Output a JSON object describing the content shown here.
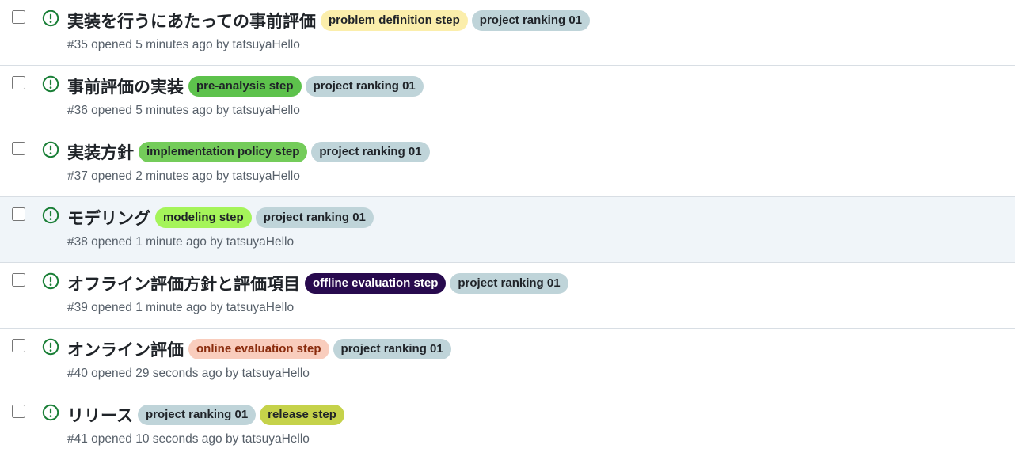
{
  "status_icon": "issue-opened-icon",
  "colors": {
    "open_icon": "#1a7f37",
    "meta_text": "#57606a",
    "row_border": "#d8dee4",
    "hover_row": "#f0f5f9"
  },
  "issues": [
    {
      "title": "実装を行うにあたっての事前評価",
      "meta": "#35 opened 5 minutes ago by tatsuyaHello",
      "labels": [
        {
          "name": "problem definition step",
          "bg": "#fbeeab",
          "fg": "#1f2328"
        },
        {
          "name": "project ranking 01",
          "bg": "#bfd4d9",
          "fg": "#1f2328"
        }
      ]
    },
    {
      "title": "事前評価の実装",
      "meta": "#36 opened 5 minutes ago by tatsuyaHello",
      "labels": [
        {
          "name": "pre-analysis step",
          "bg": "#5dc24c",
          "fg": "#1f2328"
        },
        {
          "name": "project ranking 01",
          "bg": "#bfd4d9",
          "fg": "#1f2328"
        }
      ]
    },
    {
      "title": "実装方針",
      "meta": "#37 opened 2 minutes ago by tatsuyaHello",
      "labels": [
        {
          "name": "implementation policy step",
          "bg": "#74cc5a",
          "fg": "#1f2328"
        },
        {
          "name": "project ranking 01",
          "bg": "#bfd4d9",
          "fg": "#1f2328"
        }
      ]
    },
    {
      "title": "モデリング",
      "meta": "#38 opened 1 minute ago by tatsuyaHello",
      "hovered": true,
      "labels": [
        {
          "name": "modeling step",
          "bg": "#a5f45a",
          "fg": "#1f2328"
        },
        {
          "name": "project ranking 01",
          "bg": "#bfd4d9",
          "fg": "#1f2328"
        }
      ]
    },
    {
      "title": "オフライン評価方針と評価項目",
      "meta": "#39 opened 1 minute ago by tatsuyaHello",
      "labels": [
        {
          "name": "offline evaluation step",
          "bg": "#280a4e",
          "fg": "#ffffff"
        },
        {
          "name": "project ranking 01",
          "bg": "#bfd4d9",
          "fg": "#1f2328"
        }
      ]
    },
    {
      "title": "オンライン評価",
      "meta": "#40 opened 29 seconds ago by tatsuyaHello",
      "labels": [
        {
          "name": "online evaluation step",
          "bg": "#f9cdbd",
          "fg": "#8a2c0d"
        },
        {
          "name": "project ranking 01",
          "bg": "#bfd4d9",
          "fg": "#1f2328"
        }
      ]
    },
    {
      "title": "リリース",
      "meta": "#41 opened 10 seconds ago by tatsuyaHello",
      "labels": [
        {
          "name": "project ranking 01",
          "bg": "#bfd4d9",
          "fg": "#1f2328"
        },
        {
          "name": "release step",
          "bg": "#c5d24a",
          "fg": "#1f2328"
        }
      ]
    }
  ]
}
